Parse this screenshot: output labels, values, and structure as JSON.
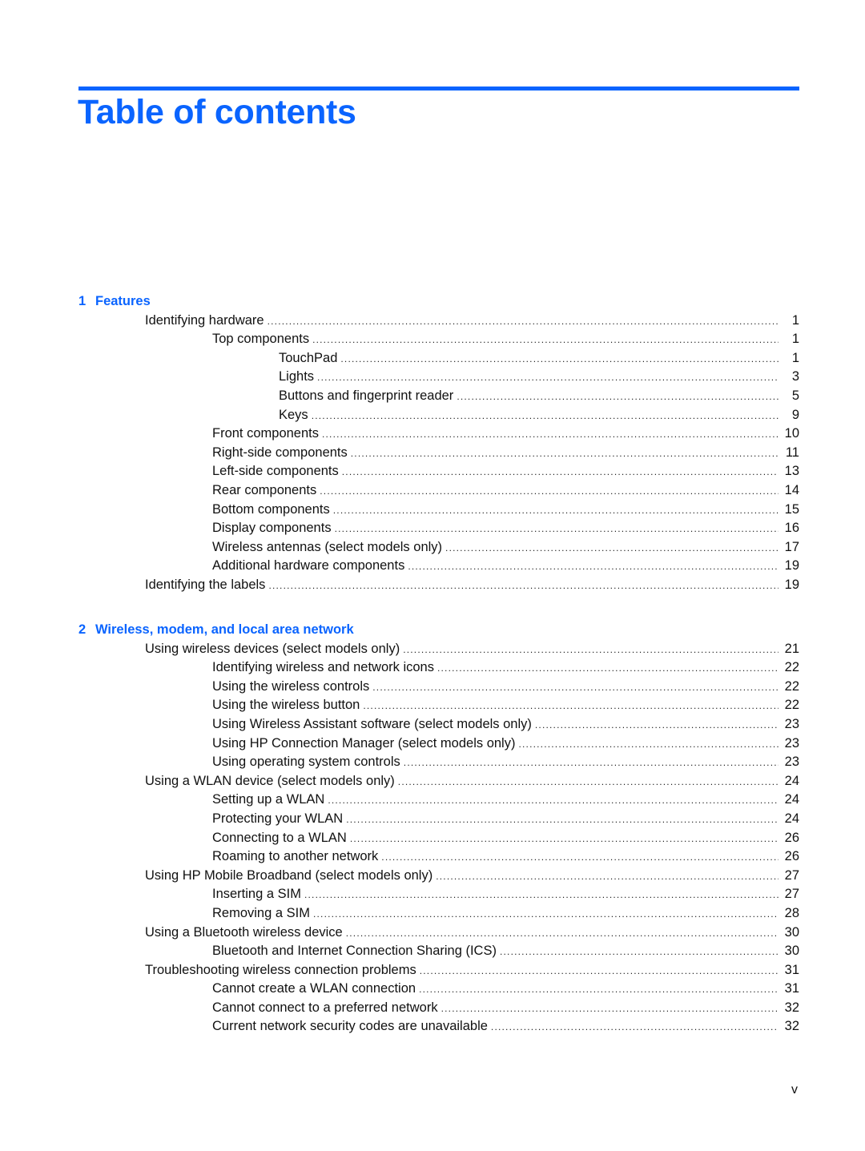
{
  "document": {
    "title": "Table of contents",
    "page_number": "v",
    "accent_color": "#0a64ff"
  },
  "chapters": [
    {
      "number": "1",
      "title": "Features",
      "entries": [
        {
          "level": 1,
          "label": "Identifying hardware",
          "page": "1"
        },
        {
          "level": 2,
          "label": "Top components",
          "page": "1"
        },
        {
          "level": 3,
          "label": "TouchPad",
          "page": "1"
        },
        {
          "level": 3,
          "label": "Lights",
          "page": "3"
        },
        {
          "level": 3,
          "label": "Buttons and fingerprint reader",
          "page": "5"
        },
        {
          "level": 3,
          "label": "Keys",
          "page": "9"
        },
        {
          "level": 2,
          "label": "Front components",
          "page": "10"
        },
        {
          "level": 2,
          "label": "Right-side components",
          "page": "11"
        },
        {
          "level": 2,
          "label": "Left-side components",
          "page": "13"
        },
        {
          "level": 2,
          "label": "Rear components",
          "page": "14"
        },
        {
          "level": 2,
          "label": "Bottom components",
          "page": "15"
        },
        {
          "level": 2,
          "label": "Display components",
          "page": "16"
        },
        {
          "level": 2,
          "label": "Wireless antennas (select models only)",
          "page": "17"
        },
        {
          "level": 2,
          "label": "Additional hardware components",
          "page": "19"
        },
        {
          "level": 1,
          "label": "Identifying the labels",
          "page": "19"
        }
      ]
    },
    {
      "number": "2",
      "title": "Wireless, modem, and local area network",
      "entries": [
        {
          "level": 1,
          "label": "Using wireless devices (select models only)",
          "page": "21"
        },
        {
          "level": 2,
          "label": "Identifying wireless and network icons",
          "page": "22"
        },
        {
          "level": 2,
          "label": "Using the wireless controls",
          "page": "22"
        },
        {
          "level": 2,
          "label": "Using the wireless button",
          "page": "22"
        },
        {
          "level": 2,
          "label": "Using Wireless Assistant software (select models only)",
          "page": "23"
        },
        {
          "level": 2,
          "label": "Using HP Connection Manager (select models only)",
          "page": "23"
        },
        {
          "level": 2,
          "label": "Using operating system controls",
          "page": "23"
        },
        {
          "level": 1,
          "label": "Using a WLAN device (select models only)",
          "page": "24"
        },
        {
          "level": 2,
          "label": "Setting up a WLAN",
          "page": "24"
        },
        {
          "level": 2,
          "label": "Protecting your WLAN",
          "page": "24"
        },
        {
          "level": 2,
          "label": "Connecting to a WLAN",
          "page": "26"
        },
        {
          "level": 2,
          "label": "Roaming to another network",
          "page": "26"
        },
        {
          "level": 1,
          "label": "Using HP Mobile Broadband (select models only)",
          "page": "27"
        },
        {
          "level": 2,
          "label": "Inserting a SIM",
          "page": "27"
        },
        {
          "level": 2,
          "label": "Removing a SIM",
          "page": "28"
        },
        {
          "level": 1,
          "label": "Using a Bluetooth wireless device",
          "page": "30"
        },
        {
          "level": 2,
          "label": "Bluetooth and Internet Connection Sharing (ICS)",
          "page": "30"
        },
        {
          "level": 1,
          "label": "Troubleshooting wireless connection problems",
          "page": "31"
        },
        {
          "level": 2,
          "label": "Cannot create a WLAN connection",
          "page": "31"
        },
        {
          "level": 2,
          "label": "Cannot connect to a preferred network",
          "page": "32"
        },
        {
          "level": 2,
          "label": "Current network security codes are unavailable",
          "page": "32"
        }
      ]
    }
  ]
}
